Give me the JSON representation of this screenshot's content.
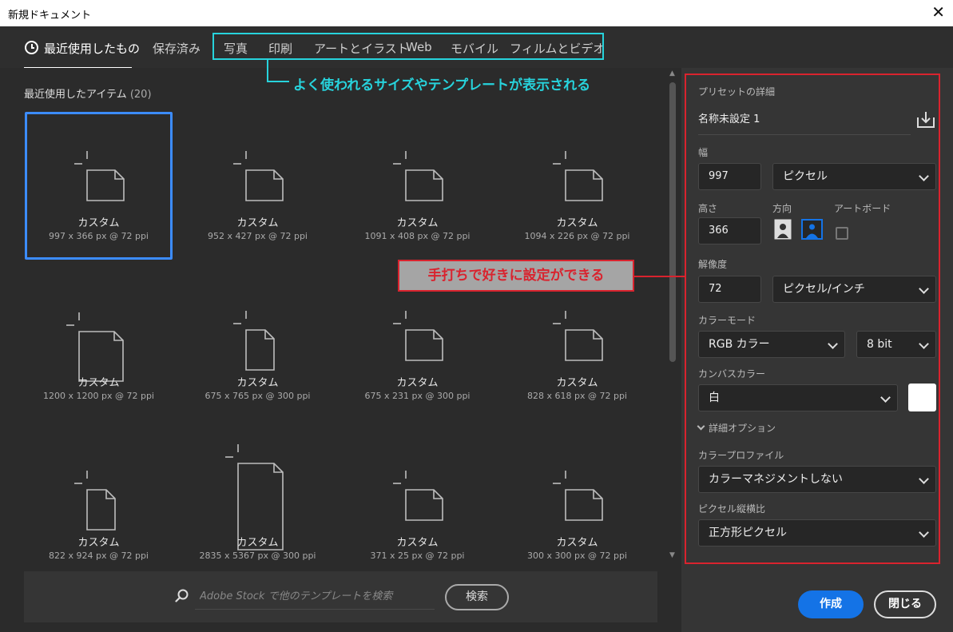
{
  "window": {
    "title": "新規ドキュメント",
    "close_glyph": "✕"
  },
  "tabs": {
    "recent": "最近使用したもの",
    "saved": "保存済み",
    "categories": [
      "写真",
      "印刷",
      "アートとイラスト",
      "Web",
      "モバイル",
      "フィルムとビデオ"
    ]
  },
  "annotations": {
    "cyan": "よく使われるサイズやテンプレートが表示される",
    "red": "手打ちで好きに設定ができる",
    "cyan_color": "#27d3dc",
    "red_color": "#d9232e"
  },
  "recent": {
    "label": "最近使用したアイテム",
    "count": "(20)",
    "items": [
      {
        "name": "カスタム",
        "dims": "997 x 366 px @ 72 ppi",
        "shape": "landscape",
        "selected": true
      },
      {
        "name": "カスタム",
        "dims": "952 x 427 px @ 72 ppi",
        "shape": "landscape"
      },
      {
        "name": "カスタム",
        "dims": "1091 x 408 px @ 72 ppi",
        "shape": "landscape"
      },
      {
        "name": "カスタム",
        "dims": "1094 x 226 px @ 72 ppi",
        "shape": "landscape"
      },
      {
        "name": "カスタム",
        "dims": "1200 x 1200 px @ 72 ppi",
        "shape": "square"
      },
      {
        "name": "カスタム",
        "dims": "675 x 765 px @ 300 ppi",
        "shape": "portrait"
      },
      {
        "name": "カスタム",
        "dims": "675 x 231 px @ 300 ppi",
        "shape": "landscape"
      },
      {
        "name": "カスタム",
        "dims": "828 x 618 px @ 72 ppi",
        "shape": "landscape"
      },
      {
        "name": "カスタム",
        "dims": "822 x 924 px @ 72 ppi",
        "shape": "portrait"
      },
      {
        "name": "カスタム",
        "dims": "2835 x 5367 px @ 300 ppi",
        "shape": "tall"
      },
      {
        "name": "カスタム",
        "dims": "371 x 25 px @ 72 ppi",
        "shape": "landscape"
      },
      {
        "name": "カスタム",
        "dims": "300 x 300 px @ 72 ppi",
        "shape": "landscape"
      }
    ]
  },
  "search": {
    "placeholder": "Adobe Stock で他のテンプレートを検索",
    "button": "検索"
  },
  "preset": {
    "section_title": "プリセットの詳細",
    "name": "名称未設定 1",
    "width_label": "幅",
    "width_value": "997",
    "width_unit": "ピクセル",
    "height_label": "高さ",
    "height_value": "366",
    "orientation_label": "方向",
    "artboard_label": "アートボード",
    "resolution_label": "解像度",
    "resolution_value": "72",
    "resolution_unit": "ピクセル/インチ",
    "color_mode_label": "カラーモード",
    "color_mode": "RGB カラー",
    "bit_depth": "8 bit",
    "canvas_color_label": "カンバスカラー",
    "canvas_color": "白",
    "advanced_label": "詳細オプション",
    "profile_label": "カラープロファイル",
    "profile": "カラーマネジメントしない",
    "aspect_label": "ピクセル縦横比",
    "aspect": "正方形ピクセル"
  },
  "buttons": {
    "create": "作成",
    "close": "閉じる"
  }
}
